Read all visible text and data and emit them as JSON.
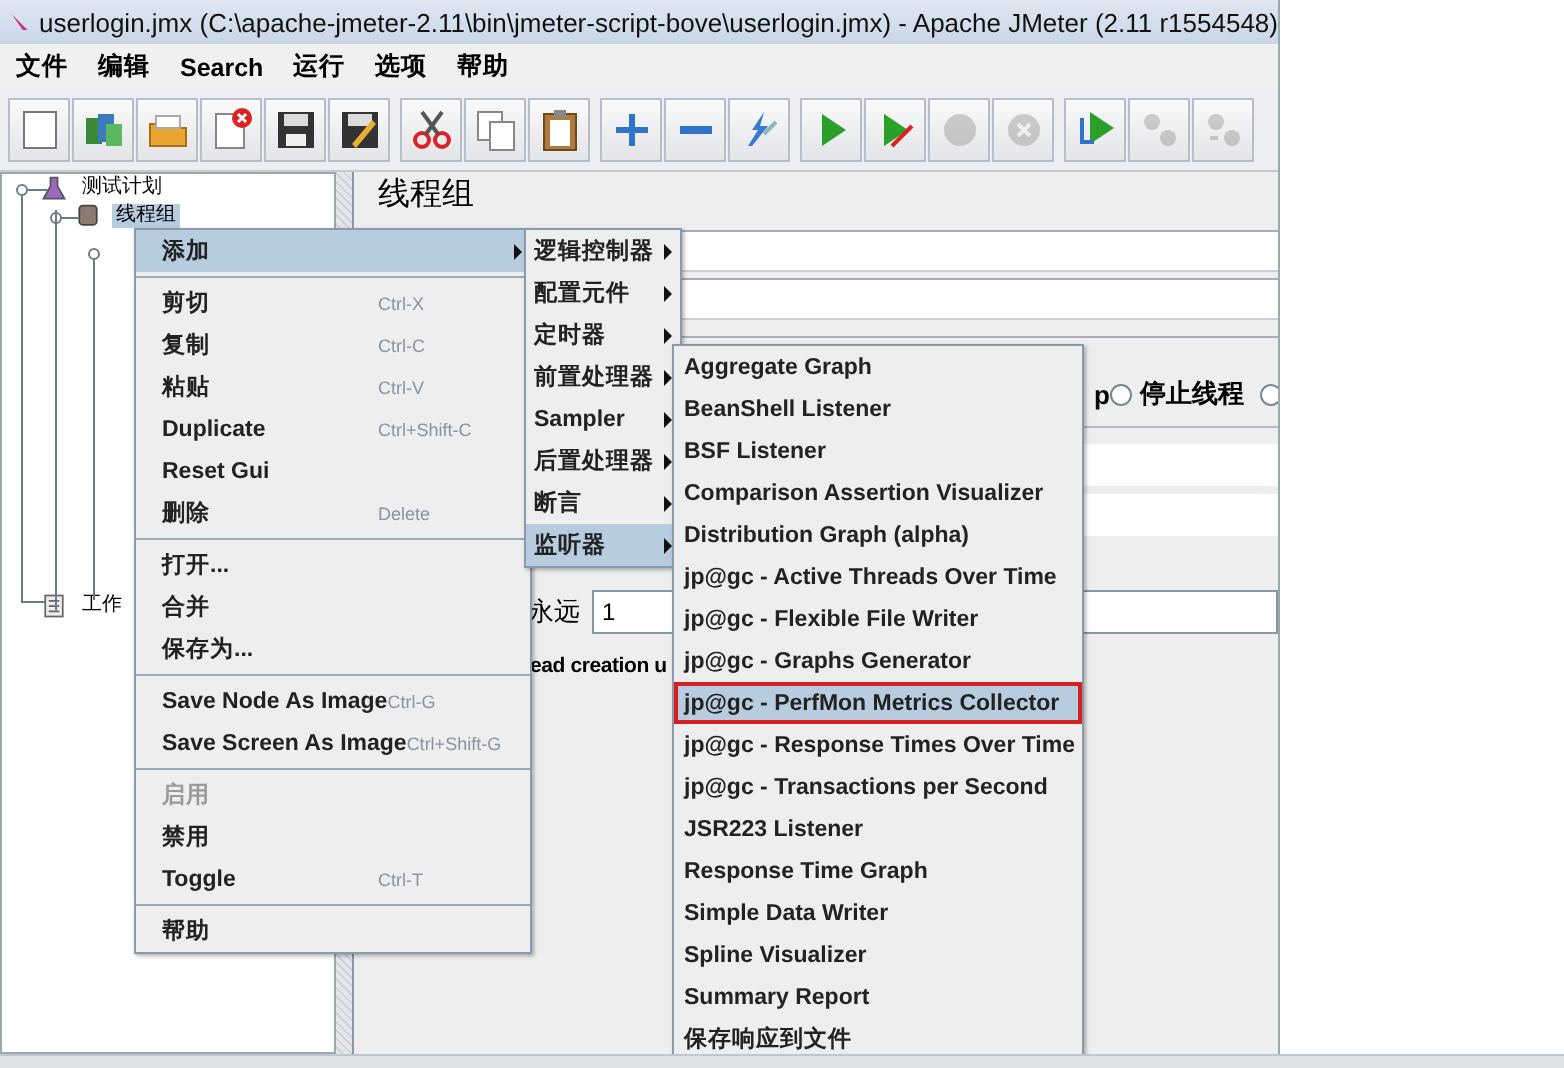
{
  "window": {
    "title": "userlogin.jmx (C:\\apache-jmeter-2.11\\bin\\jmeter-script-bove\\userlogin.jmx) - Apache JMeter (2.11 r1554548)"
  },
  "menu_bar": [
    "文件",
    "编辑",
    "Search",
    "运行",
    "选项",
    "帮助"
  ],
  "toolbar": [
    [
      {
        "kind": "new",
        "disabled": false
      },
      {
        "kind": "templates",
        "disabled": false
      },
      {
        "kind": "open",
        "disabled": false
      },
      {
        "kind": "close",
        "disabled": false
      },
      {
        "kind": "save",
        "disabled": false
      },
      {
        "kind": "save-as",
        "disabled": false
      }
    ],
    [
      {
        "kind": "cut",
        "disabled": false
      },
      {
        "kind": "copy",
        "disabled": false
      },
      {
        "kind": "paste",
        "disabled": false
      }
    ],
    [
      {
        "kind": "expand",
        "disabled": false
      },
      {
        "kind": "collapse",
        "disabled": false
      },
      {
        "kind": "toggle",
        "disabled": false
      }
    ],
    [
      {
        "kind": "start",
        "disabled": false
      },
      {
        "kind": "start-no-pauses",
        "disabled": false
      },
      {
        "kind": "stop",
        "disabled": true
      },
      {
        "kind": "shutdown",
        "disabled": true
      }
    ],
    [
      {
        "kind": "remote-start",
        "disabled": false
      },
      {
        "kind": "remote-stop",
        "disabled": true
      },
      {
        "kind": "remote-shutdown",
        "disabled": true
      }
    ]
  ],
  "tree": [
    {
      "label": "测试计划",
      "kind": "plan",
      "selected": false,
      "children": [
        {
          "label": "线程组",
          "kind": "thread-group",
          "selected": true
        }
      ]
    },
    {
      "label": "工作",
      "kind": "workbench",
      "selected": false
    }
  ],
  "panel": {
    "title": "线程组",
    "error_action_fragment": "p",
    "stop_thread_option": {
      "label": "停止线程",
      "selected": false
    },
    "next_option": {
      "selected": false
    },
    "loop_label": "永远",
    "loop_value": "1",
    "delay_fragment": "ead creation u"
  },
  "context_menu": [
    {
      "kind": "item",
      "label": "添加",
      "submenu": true,
      "selected": true,
      "disabled": false
    },
    {
      "kind": "separator"
    },
    {
      "kind": "item",
      "label": "剪切",
      "shortcut": "Ctrl-X",
      "submenu": false,
      "selected": false,
      "disabled": false
    },
    {
      "kind": "item",
      "label": "复制",
      "shortcut": "Ctrl-C",
      "submenu": false,
      "selected": false,
      "disabled": false
    },
    {
      "kind": "item",
      "label": "粘贴",
      "shortcut": "Ctrl-V",
      "submenu": false,
      "selected": false,
      "disabled": false
    },
    {
      "kind": "item",
      "label": "Duplicate",
      "shortcut": "Ctrl+Shift-C",
      "submenu": false,
      "selected": false,
      "disabled": false
    },
    {
      "kind": "item",
      "label": "Reset Gui",
      "submenu": false,
      "selected": false,
      "disabled": false
    },
    {
      "kind": "item",
      "label": "删除",
      "shortcut": "Delete",
      "submenu": false,
      "selected": false,
      "disabled": false
    },
    {
      "kind": "separator"
    },
    {
      "kind": "item",
      "label": "打开...",
      "submenu": false,
      "selected": false,
      "disabled": false
    },
    {
      "kind": "item",
      "label": "合并",
      "submenu": false,
      "selected": false,
      "disabled": false
    },
    {
      "kind": "item",
      "label": "保存为...",
      "submenu": false,
      "selected": false,
      "disabled": false
    },
    {
      "kind": "separator"
    },
    {
      "kind": "item",
      "label": "Save Node As Image",
      "shortcut": "Ctrl-G",
      "submenu": false,
      "selected": false,
      "disabled": false
    },
    {
      "kind": "item",
      "label": "Save Screen As Image",
      "shortcut": "Ctrl+Shift-G",
      "submenu": false,
      "selected": false,
      "disabled": false
    },
    {
      "kind": "separator"
    },
    {
      "kind": "item",
      "label": "启用",
      "submenu": false,
      "selected": false,
      "disabled": true
    },
    {
      "kind": "item",
      "label": "禁用",
      "submenu": false,
      "selected": false,
      "disabled": false
    },
    {
      "kind": "item",
      "label": "Toggle",
      "shortcut": "Ctrl-T",
      "submenu": false,
      "selected": false,
      "disabled": false
    },
    {
      "kind": "separator"
    },
    {
      "kind": "item",
      "label": "帮助",
      "submenu": false,
      "selected": false,
      "disabled": false
    }
  ],
  "add_submenu": [
    {
      "kind": "item",
      "label": "逻辑控制器",
      "submenu": true,
      "selected": false
    },
    {
      "kind": "item",
      "label": "配置元件",
      "submenu": true,
      "selected": false
    },
    {
      "kind": "item",
      "label": "定时器",
      "submenu": true,
      "selected": false
    },
    {
      "kind": "item",
      "label": "前置处理器",
      "submenu": true,
      "selected": false
    },
    {
      "kind": "item",
      "label": "Sampler",
      "submenu": true,
      "selected": false
    },
    {
      "kind": "item",
      "label": "后置处理器",
      "submenu": true,
      "selected": false
    },
    {
      "kind": "item",
      "label": "断言",
      "submenu": true,
      "selected": false
    },
    {
      "kind": "item",
      "label": "监听器",
      "submenu": true,
      "selected": true
    }
  ],
  "listener_submenu": [
    {
      "kind": "item",
      "label": "Aggregate Graph",
      "selected": false,
      "outlined": false
    },
    {
      "kind": "item",
      "label": "BeanShell Listener",
      "selected": false,
      "outlined": false
    },
    {
      "kind": "item",
      "label": "BSF Listener",
      "selected": false,
      "outlined": false
    },
    {
      "kind": "item",
      "label": "Comparison Assertion Visualizer",
      "selected": false,
      "outlined": false
    },
    {
      "kind": "item",
      "label": "Distribution Graph (alpha)",
      "selected": false,
      "outlined": false
    },
    {
      "kind": "item",
      "label": "jp@gc - Active Threads Over Time",
      "selected": false,
      "outlined": false
    },
    {
      "kind": "item",
      "label": "jp@gc - Flexible File Writer",
      "selected": false,
      "outlined": false
    },
    {
      "kind": "item",
      "label": "jp@gc - Graphs Generator",
      "selected": false,
      "outlined": false
    },
    {
      "kind": "item",
      "label": "jp@gc - PerfMon Metrics Collector",
      "selected": true,
      "outlined": true
    },
    {
      "kind": "item",
      "label": "jp@gc - Response Times Over Time",
      "selected": false,
      "outlined": false
    },
    {
      "kind": "item",
      "label": "jp@gc - Transactions per Second",
      "selected": false,
      "outlined": false
    },
    {
      "kind": "item",
      "label": "JSR223 Listener",
      "selected": false,
      "outlined": false
    },
    {
      "kind": "item",
      "label": "Response Time Graph",
      "selected": false,
      "outlined": false
    },
    {
      "kind": "item",
      "label": "Simple Data Writer",
      "selected": false,
      "outlined": false
    },
    {
      "kind": "item",
      "label": "Spline Visualizer",
      "selected": false,
      "outlined": false
    },
    {
      "kind": "item",
      "label": "Summary Report",
      "selected": false,
      "outlined": false
    },
    {
      "kind": "item",
      "label": "保存响应到文件",
      "selected": false,
      "outlined": false
    }
  ]
}
